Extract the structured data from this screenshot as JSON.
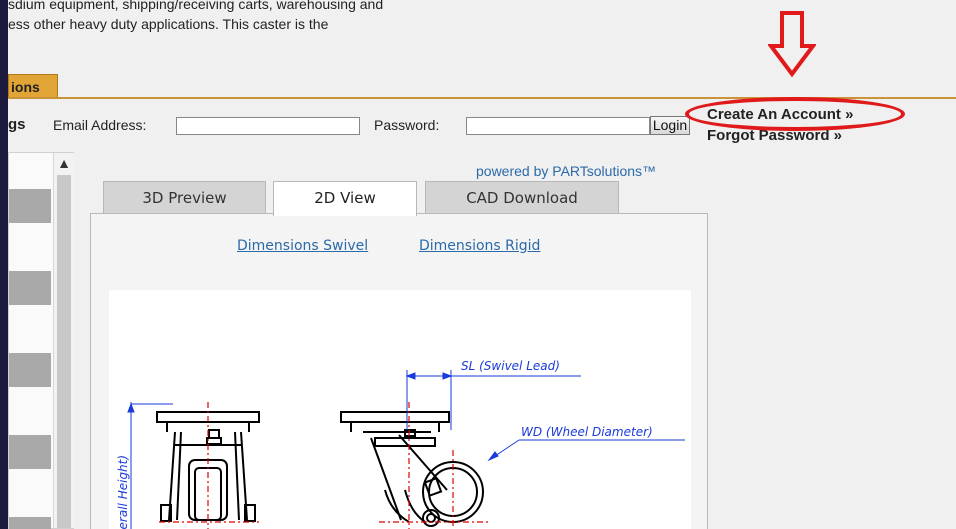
{
  "description": {
    "line1": "sdium equipment, shipping/receiving carts, warehousing and",
    "line2": "ess other heavy duty applications. This caster is the"
  },
  "tabs_header": {
    "label": "ions"
  },
  "login": {
    "side_label": "gs",
    "email_label": "Email Address:",
    "email_value": "",
    "password_label": "Password:",
    "password_value": "",
    "login_button": "Login",
    "create_account": "Create An Account »",
    "forgot_password": "Forgot Password »"
  },
  "viewer": {
    "powered_by": "powered by PARTsolutions™",
    "tabs": [
      {
        "label": "3D Preview",
        "active": false
      },
      {
        "label": "2D View",
        "active": true
      },
      {
        "label": "CAD Download",
        "active": false
      }
    ],
    "links": [
      "Dimensions Swivel",
      "Dimensions Rigid"
    ],
    "drawing": {
      "sl_label": "SL (Swivel Lead)",
      "wd_label": "WD (Wheel Diameter)",
      "oh_label": "Overall Height)"
    }
  },
  "annotation": {
    "highlight_color": "#e01a1a",
    "icon": "down-arrow-icon"
  }
}
